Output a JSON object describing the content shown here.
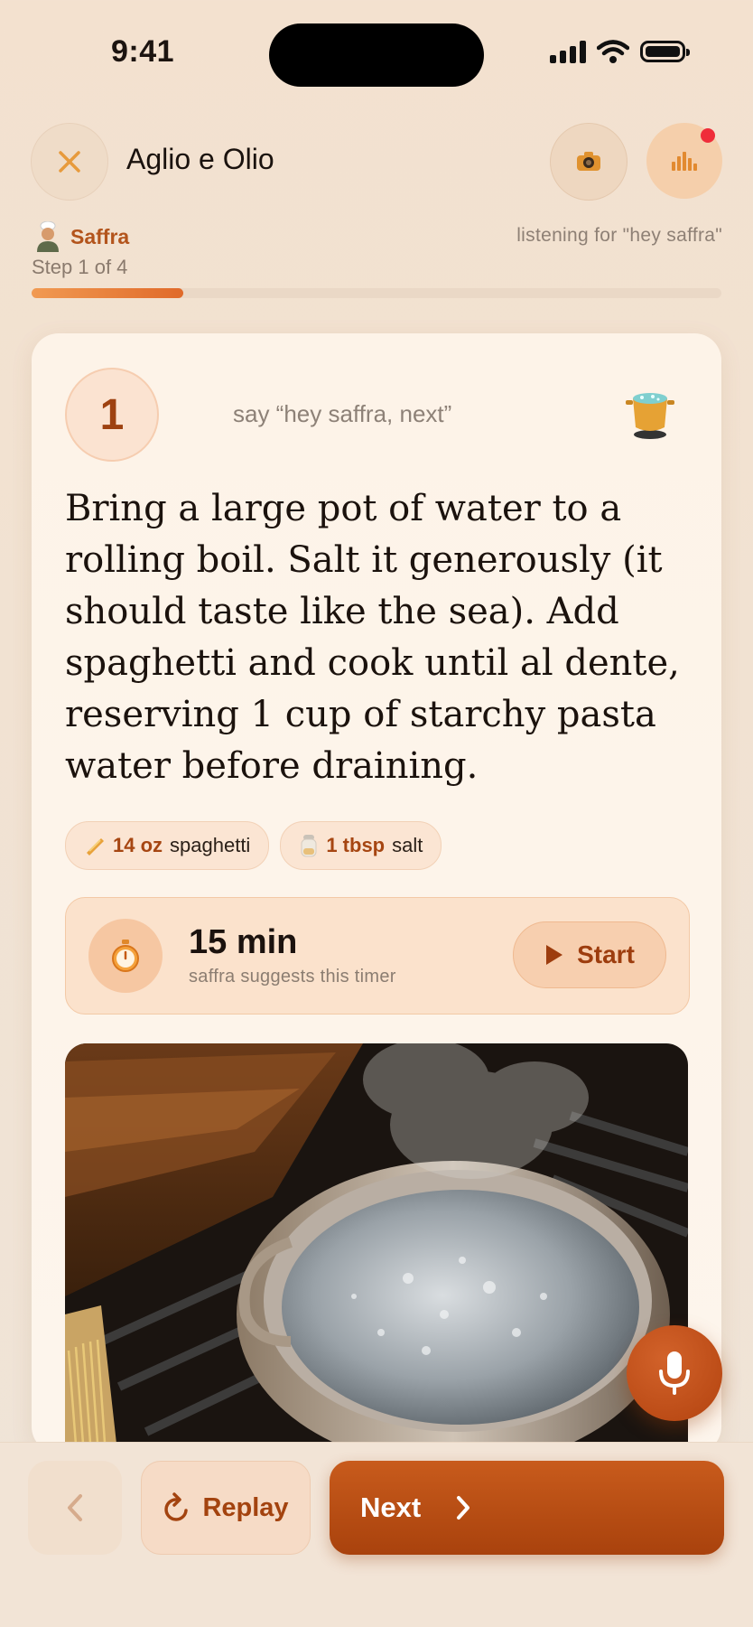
{
  "status_bar": {
    "time": "9:41"
  },
  "header": {
    "title": "Aglio e Olio"
  },
  "assistant": {
    "name": "Saffra",
    "listening_text": "listening for \"hey saffra\""
  },
  "step": {
    "label": "Step 1 of 4",
    "number": "1",
    "progress": 0.22
  },
  "card": {
    "voice_hint": "say “hey saffra, next”",
    "instructions": "Bring a large pot of water to a rolling boil. Salt it generously (it should taste like the sea). Add spaghetti and cook until al dente, reserving 1 cup of starchy pasta water before draining.",
    "ingredients": [
      {
        "icon": "pasta-icon",
        "qty": "14 oz",
        "name": "spaghetti"
      },
      {
        "icon": "salt-shaker-icon",
        "qty": "1 tbsp",
        "name": "salt"
      }
    ],
    "timer": {
      "value": "15 min",
      "subtitle": "saffra suggests this timer",
      "start_label": "Start"
    }
  },
  "bottom": {
    "replay_label": "Replay",
    "next_label": "Next"
  },
  "colors": {
    "accent": "#b3430f",
    "accent_light": "#fbe2cc",
    "background": "#f3e1cf"
  }
}
